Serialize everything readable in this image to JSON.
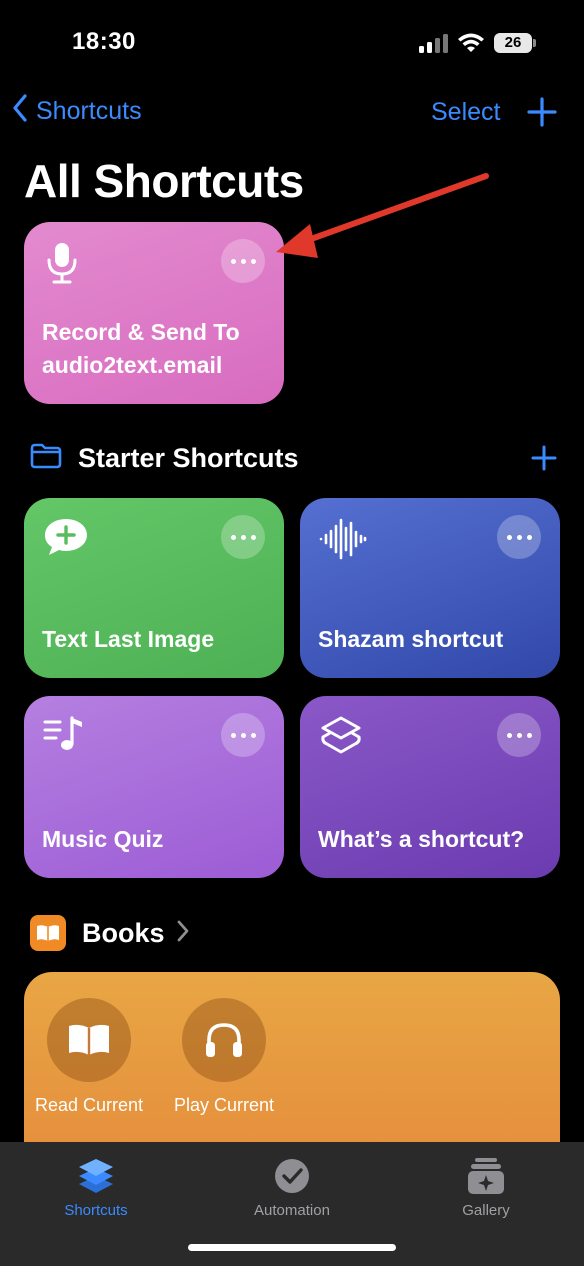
{
  "status_bar": {
    "time": "18:30",
    "battery": "26"
  },
  "nav": {
    "back_label": "Shortcuts",
    "select_label": "Select"
  },
  "page_title": "All Shortcuts",
  "pinned_shortcut": {
    "label": "Record & Send To audio2text.email",
    "icon": "microphone-icon",
    "color": "#dd78c6"
  },
  "starter_section": {
    "title": "Starter Shortcuts",
    "items": [
      {
        "label": "Text Last Image",
        "icon": "message-plus-icon",
        "color": "#58bb5e"
      },
      {
        "label": "Shazam shortcut",
        "icon": "waveform-icon",
        "color": "#3f5bbd"
      },
      {
        "label": "Music Quiz",
        "icon": "music-list-icon",
        "color": "#a86bdb"
      },
      {
        "label": "What’s a shortcut?",
        "icon": "shortcuts-layers-icon",
        "color": "#7a49bc"
      }
    ]
  },
  "books_section": {
    "title": "Books",
    "items": [
      {
        "label": "Read Current",
        "icon": "book-icon"
      },
      {
        "label": "Play Current",
        "icon": "headphones-icon"
      }
    ]
  },
  "tab_bar": {
    "tabs": [
      {
        "label": "Shortcuts",
        "icon": "shortcuts-icon",
        "active": true
      },
      {
        "label": "Automation",
        "icon": "clock-check-icon",
        "active": false
      },
      {
        "label": "Gallery",
        "icon": "gallery-icon",
        "active": false
      }
    ]
  },
  "colors": {
    "accent": "#3a8bff",
    "annotation_arrow": "#e0392b",
    "books_icon": "#f08a24"
  }
}
